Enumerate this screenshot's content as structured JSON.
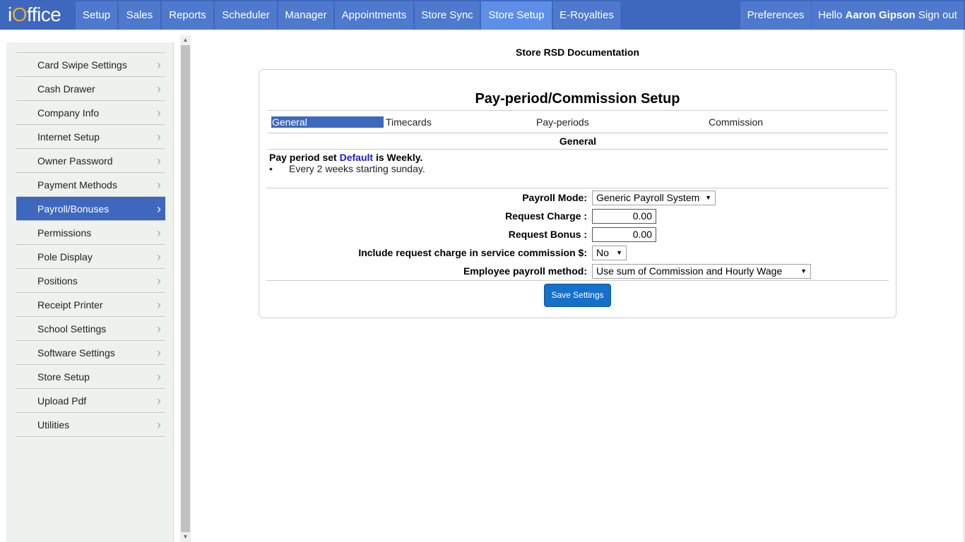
{
  "app": {
    "logo_prefix": "i",
    "logo_o": "O",
    "logo_rest": "ffice"
  },
  "nav": {
    "items": [
      {
        "label": "Setup"
      },
      {
        "label": "Sales"
      },
      {
        "label": "Reports"
      },
      {
        "label": "Scheduler"
      },
      {
        "label": "Manager"
      },
      {
        "label": "Appointments"
      },
      {
        "label": "Store Sync"
      },
      {
        "label": "Store Setup",
        "active": true
      },
      {
        "label": "E-Royalties"
      }
    ],
    "preferences": "Preferences",
    "hello": "Hello",
    "user_name": "Aaron Gipson",
    "sign_out": "Sign out"
  },
  "sidebar": {
    "items": [
      {
        "label": "Card Swipe Settings"
      },
      {
        "label": "Cash Drawer"
      },
      {
        "label": "Company Info"
      },
      {
        "label": "Internet Setup"
      },
      {
        "label": "Owner Password"
      },
      {
        "label": "Payment Methods"
      },
      {
        "label": "Payroll/Bonuses",
        "active": true
      },
      {
        "label": "Permissions"
      },
      {
        "label": "Pole Display"
      },
      {
        "label": "Positions"
      },
      {
        "label": "Receipt Printer"
      },
      {
        "label": "School Settings"
      },
      {
        "label": "Software Settings"
      },
      {
        "label": "Store Setup"
      },
      {
        "label": "Upload Pdf"
      },
      {
        "label": "Utilities"
      }
    ]
  },
  "main": {
    "doc_title": "Store RSD Documentation",
    "card_title": "Pay-period/Commission Setup",
    "tabs": [
      {
        "label": "General",
        "active": true
      },
      {
        "label": "Timecards"
      },
      {
        "label": "Pay-periods"
      },
      {
        "label": "Commission"
      }
    ],
    "section_heading": "General",
    "pay_period": {
      "prefix": "Pay period set",
      "link": "Default",
      "suffix": "is Weekly.",
      "detail": "Every 2 weeks starting sunday."
    },
    "form": {
      "payroll_mode_label": "Payroll Mode:",
      "payroll_mode_value": "Generic Payroll System",
      "request_charge_label": "Request Charge :",
      "request_charge_value": "0.00",
      "request_bonus_label": "Request Bonus :",
      "request_bonus_value": "0.00",
      "include_charge_label": "Include request charge in service commission $:",
      "include_charge_value": "No",
      "employee_method_label": "Employee payroll method:",
      "employee_method_value": "Use sum of Commission and Hourly Wage"
    },
    "save_label": "Save Settings"
  }
}
